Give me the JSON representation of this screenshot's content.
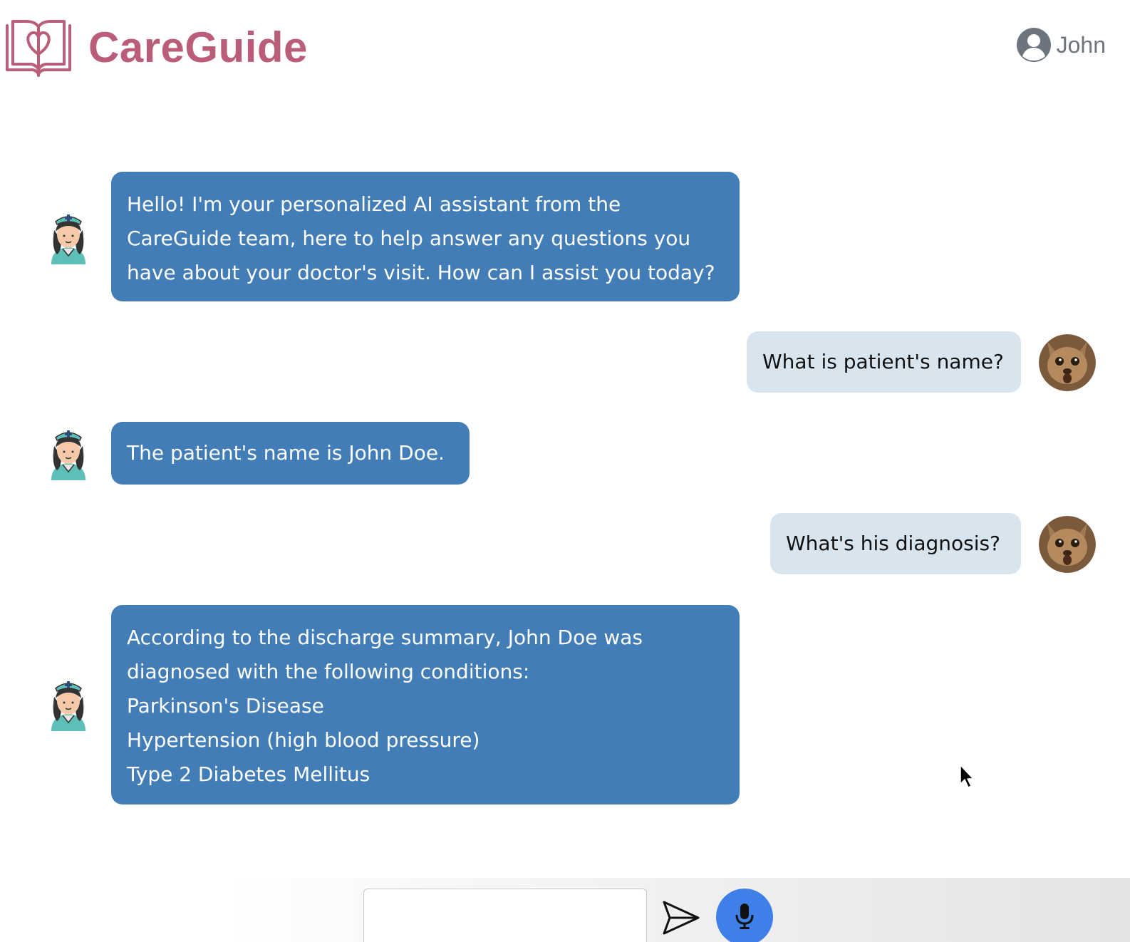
{
  "header": {
    "brand": "CareGuide",
    "user_name": "John",
    "icons": {
      "logo": "book-heart-icon",
      "user": "user-circle-icon"
    }
  },
  "messages": [
    {
      "role": "assistant",
      "lines": [
        "Hello! I'm your personalized AI assistant from the",
        "CareGuide team, here to help answer any questions you",
        "have about your doctor's visit. How can I assist you today?"
      ]
    },
    {
      "role": "user",
      "lines": [
        "What is patient's name?"
      ]
    },
    {
      "role": "assistant",
      "lines": [
        "The patient's name is John Doe."
      ]
    },
    {
      "role": "user",
      "lines": [
        "What's his diagnosis?"
      ]
    },
    {
      "role": "assistant",
      "lines": [
        "According to the discharge summary, John Doe was",
        "diagnosed with the following conditions:",
        "Parkinson's Disease",
        "Hypertension (high blood pressure)",
        "Type 2 Diabetes Mellitus"
      ]
    }
  ],
  "composer": {
    "input_value": "",
    "input_placeholder": "",
    "icons": {
      "send": "paper-plane-icon",
      "mic": "microphone-icon"
    }
  },
  "colors": {
    "brand": "#b95d78",
    "assistant_bubble": "#427db7",
    "user_bubble": "#d8e5ee",
    "mic_button": "#3e7fe8"
  }
}
